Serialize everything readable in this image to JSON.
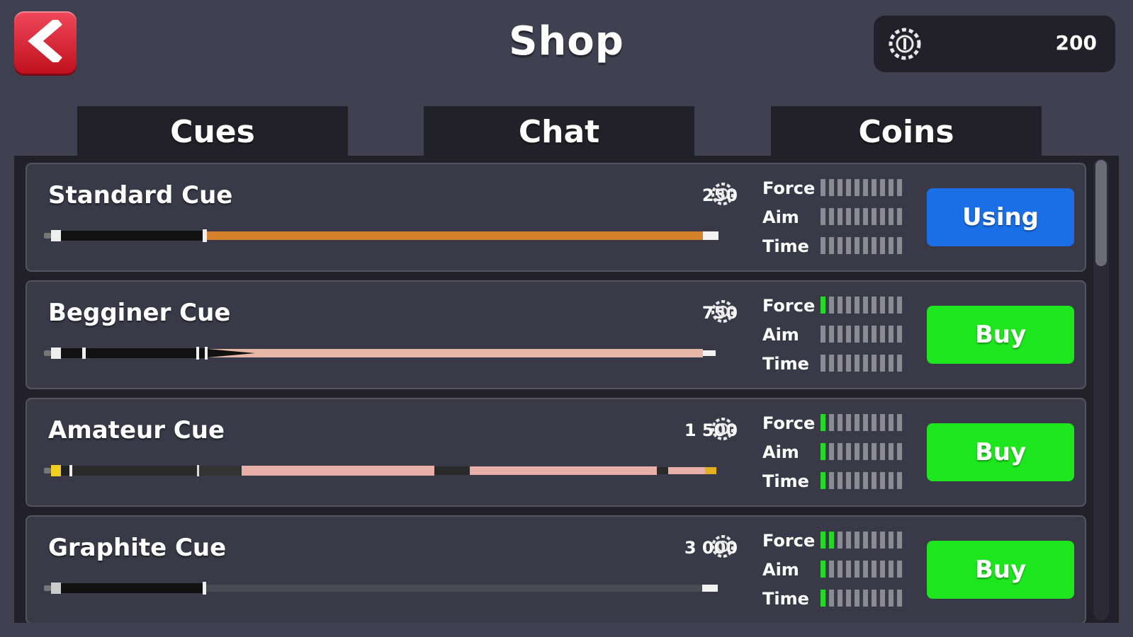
{
  "header": {
    "title": "Shop",
    "back_icon": "chevron-left-icon",
    "coin_icon": "coin-icon",
    "coins": "200"
  },
  "tabs": [
    {
      "label": "Cues"
    },
    {
      "label": "Chat"
    },
    {
      "label": "Coins"
    }
  ],
  "stat_labels": {
    "force": "Force",
    "aim": "Aim",
    "time": "Time"
  },
  "stat_scale_max": 10,
  "cues": [
    {
      "name": "Standard Cue",
      "price": "250",
      "stats": {
        "force": 0,
        "aim": 0,
        "time": 0
      },
      "action": "Using",
      "action_state": "using",
      "shaft_color": "#d6822c"
    },
    {
      "name": "Begginer Cue",
      "price": "750",
      "stats": {
        "force": 1,
        "aim": 0,
        "time": 0
      },
      "action": "Buy",
      "action_state": "buy",
      "shaft_color": "#e8b8a8"
    },
    {
      "name": "Amateur Cue",
      "price": "1 500",
      "stats": {
        "force": 1,
        "aim": 1,
        "time": 1
      },
      "action": "Buy",
      "action_state": "buy",
      "shaft_color": "#e8b0a8"
    },
    {
      "name": "Graphite Cue",
      "price": "3 000",
      "stats": {
        "force": 2,
        "aim": 1,
        "time": 1
      },
      "action": "Buy",
      "action_state": "buy",
      "shaft_color": "#4a4a52"
    }
  ],
  "colors": {
    "background": "#414050",
    "panel": "#222129",
    "card": "#3a3947",
    "using_button": "#1a6ee6",
    "buy_button": "#1ee61e",
    "stat_fill": "#26d926",
    "stat_empty": "#8a8994",
    "back_button": "#e0283a"
  }
}
